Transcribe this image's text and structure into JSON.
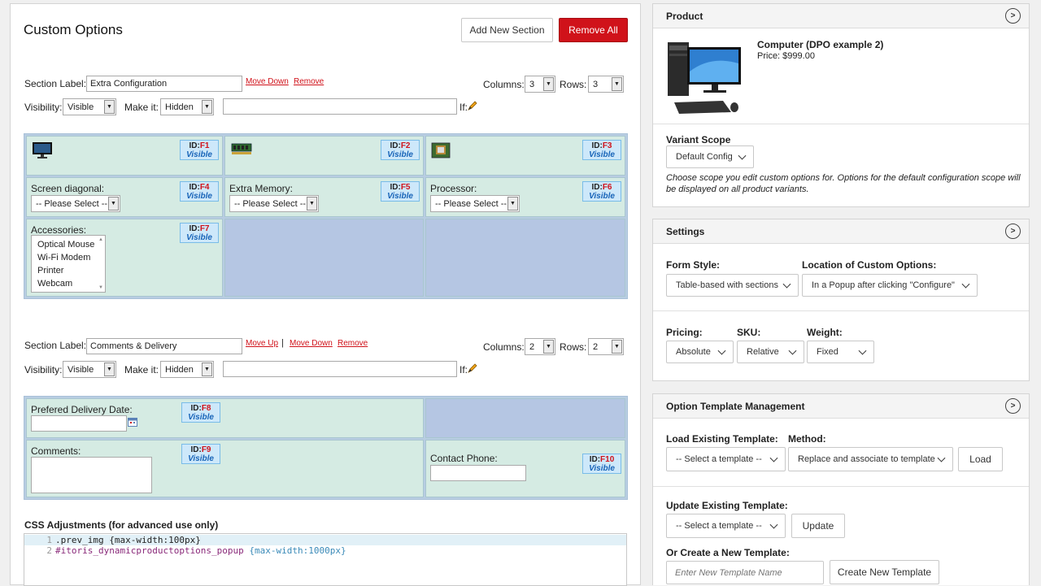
{
  "left": {
    "title": "Custom Options",
    "add_section_label": "Add New Section",
    "remove_all_label": "Remove All",
    "section1": {
      "label_caption": "Section Label:",
      "label_value": "Extra Configuration",
      "move_down": "Move Down",
      "remove": "Remove",
      "columns_caption": "Columns:",
      "columns_value": "3",
      "rows_caption": "Rows:",
      "rows_value": "3",
      "visibility_caption": "Visibility:",
      "visibility_value": "Visible",
      "make_it_caption": "Make it:",
      "make_it_value": "Hidden",
      "if_caption": "If:",
      "cells": [
        {
          "id_prefix": "ID:",
          "id": "F1",
          "vis": "Visible"
        },
        {
          "id_prefix": "ID:",
          "id": "F2",
          "vis": "Visible"
        },
        {
          "id_prefix": "ID:",
          "id": "F3",
          "vis": "Visible"
        },
        {
          "label": "Screen diagonal:",
          "select": "-- Please Select --",
          "id_prefix": "ID:",
          "id": "F4",
          "vis": "Visible"
        },
        {
          "label": "Extra Memory:",
          "select": "-- Please Select --",
          "id_prefix": "ID:",
          "id": "F5",
          "vis": "Visible"
        },
        {
          "label": "Processor:",
          "select": "-- Please Select --",
          "id_prefix": "ID:",
          "id": "F6",
          "vis": "Visible"
        },
        {
          "label": "Accessories:",
          "options": [
            "Optical Mouse",
            "Wi-Fi Modem",
            "Printer",
            "Webcam"
          ],
          "id_prefix": "ID:",
          "id": "F7",
          "vis": "Visible"
        }
      ]
    },
    "section2": {
      "label_caption": "Section Label:",
      "label_value": "Comments & Delivery",
      "move_up": "Move Up",
      "separator": "|",
      "move_down": "Move Down",
      "remove": "Remove",
      "columns_caption": "Columns:",
      "columns_value": "2",
      "rows_caption": "Rows:",
      "rows_value": "2",
      "visibility_caption": "Visibility:",
      "visibility_value": "Visible",
      "make_it_caption": "Make it:",
      "make_it_value": "Hidden",
      "if_caption": "If:",
      "cells": [
        {
          "label": "Prefered Delivery Date:",
          "id_prefix": "ID:",
          "id": "F8",
          "vis": "Visible"
        },
        {
          "label": "Comments:",
          "id_prefix": "ID:",
          "id": "F9",
          "vis": "Visible"
        },
        {
          "label": "Contact Phone:",
          "id_prefix": "ID:",
          "id": "F10",
          "vis": "Visible"
        }
      ]
    },
    "css": {
      "heading": "CSS Adjustments (for advanced use only)",
      "lines": [
        {
          "n": "1",
          "selector": ".prev_img",
          "body": "{max-width:100px}"
        },
        {
          "n": "2",
          "selector": "#itoris_dynamicproductoptions_popup",
          "body": "{max-width:1000px}"
        }
      ]
    }
  },
  "product": {
    "heading": "Product",
    "name": "Computer (DPO example 2)",
    "price": "Price: $999.00",
    "variant_scope_label": "Variant Scope",
    "variant_scope_value": "Default Config",
    "variant_note": "Choose scope you edit custom options for. Options for the default configuration scope will be displayed on all product variants."
  },
  "settings": {
    "heading": "Settings",
    "form_style_label": "Form Style:",
    "form_style_value": "Table-based with sections",
    "location_label": "Location of Custom Options:",
    "location_value": "In a Popup after clicking \"Configure\"",
    "pricing_label": "Pricing:",
    "pricing_value": "Absolute",
    "sku_label": "SKU:",
    "sku_value": "Relative",
    "weight_label": "Weight:",
    "weight_value": "Fixed"
  },
  "templates": {
    "heading": "Option Template Management",
    "load_label": "Load Existing Template:",
    "load_value": "-- Select a template --",
    "method_label": "Method:",
    "method_value": "Replace and associate to template",
    "load_button": "Load",
    "update_label": "Update Existing Template:",
    "update_value": "-- Select a template --",
    "update_button": "Update",
    "create_label": "Or Create a New Template:",
    "create_placeholder": "Enter New Template Name",
    "create_button": "Create New Template"
  },
  "colors": {
    "accent_red": "#d0121a",
    "visible_blue": "#1864b8",
    "cell_green": "#d5ebe3",
    "cell_empty": "#b5c6e3"
  }
}
